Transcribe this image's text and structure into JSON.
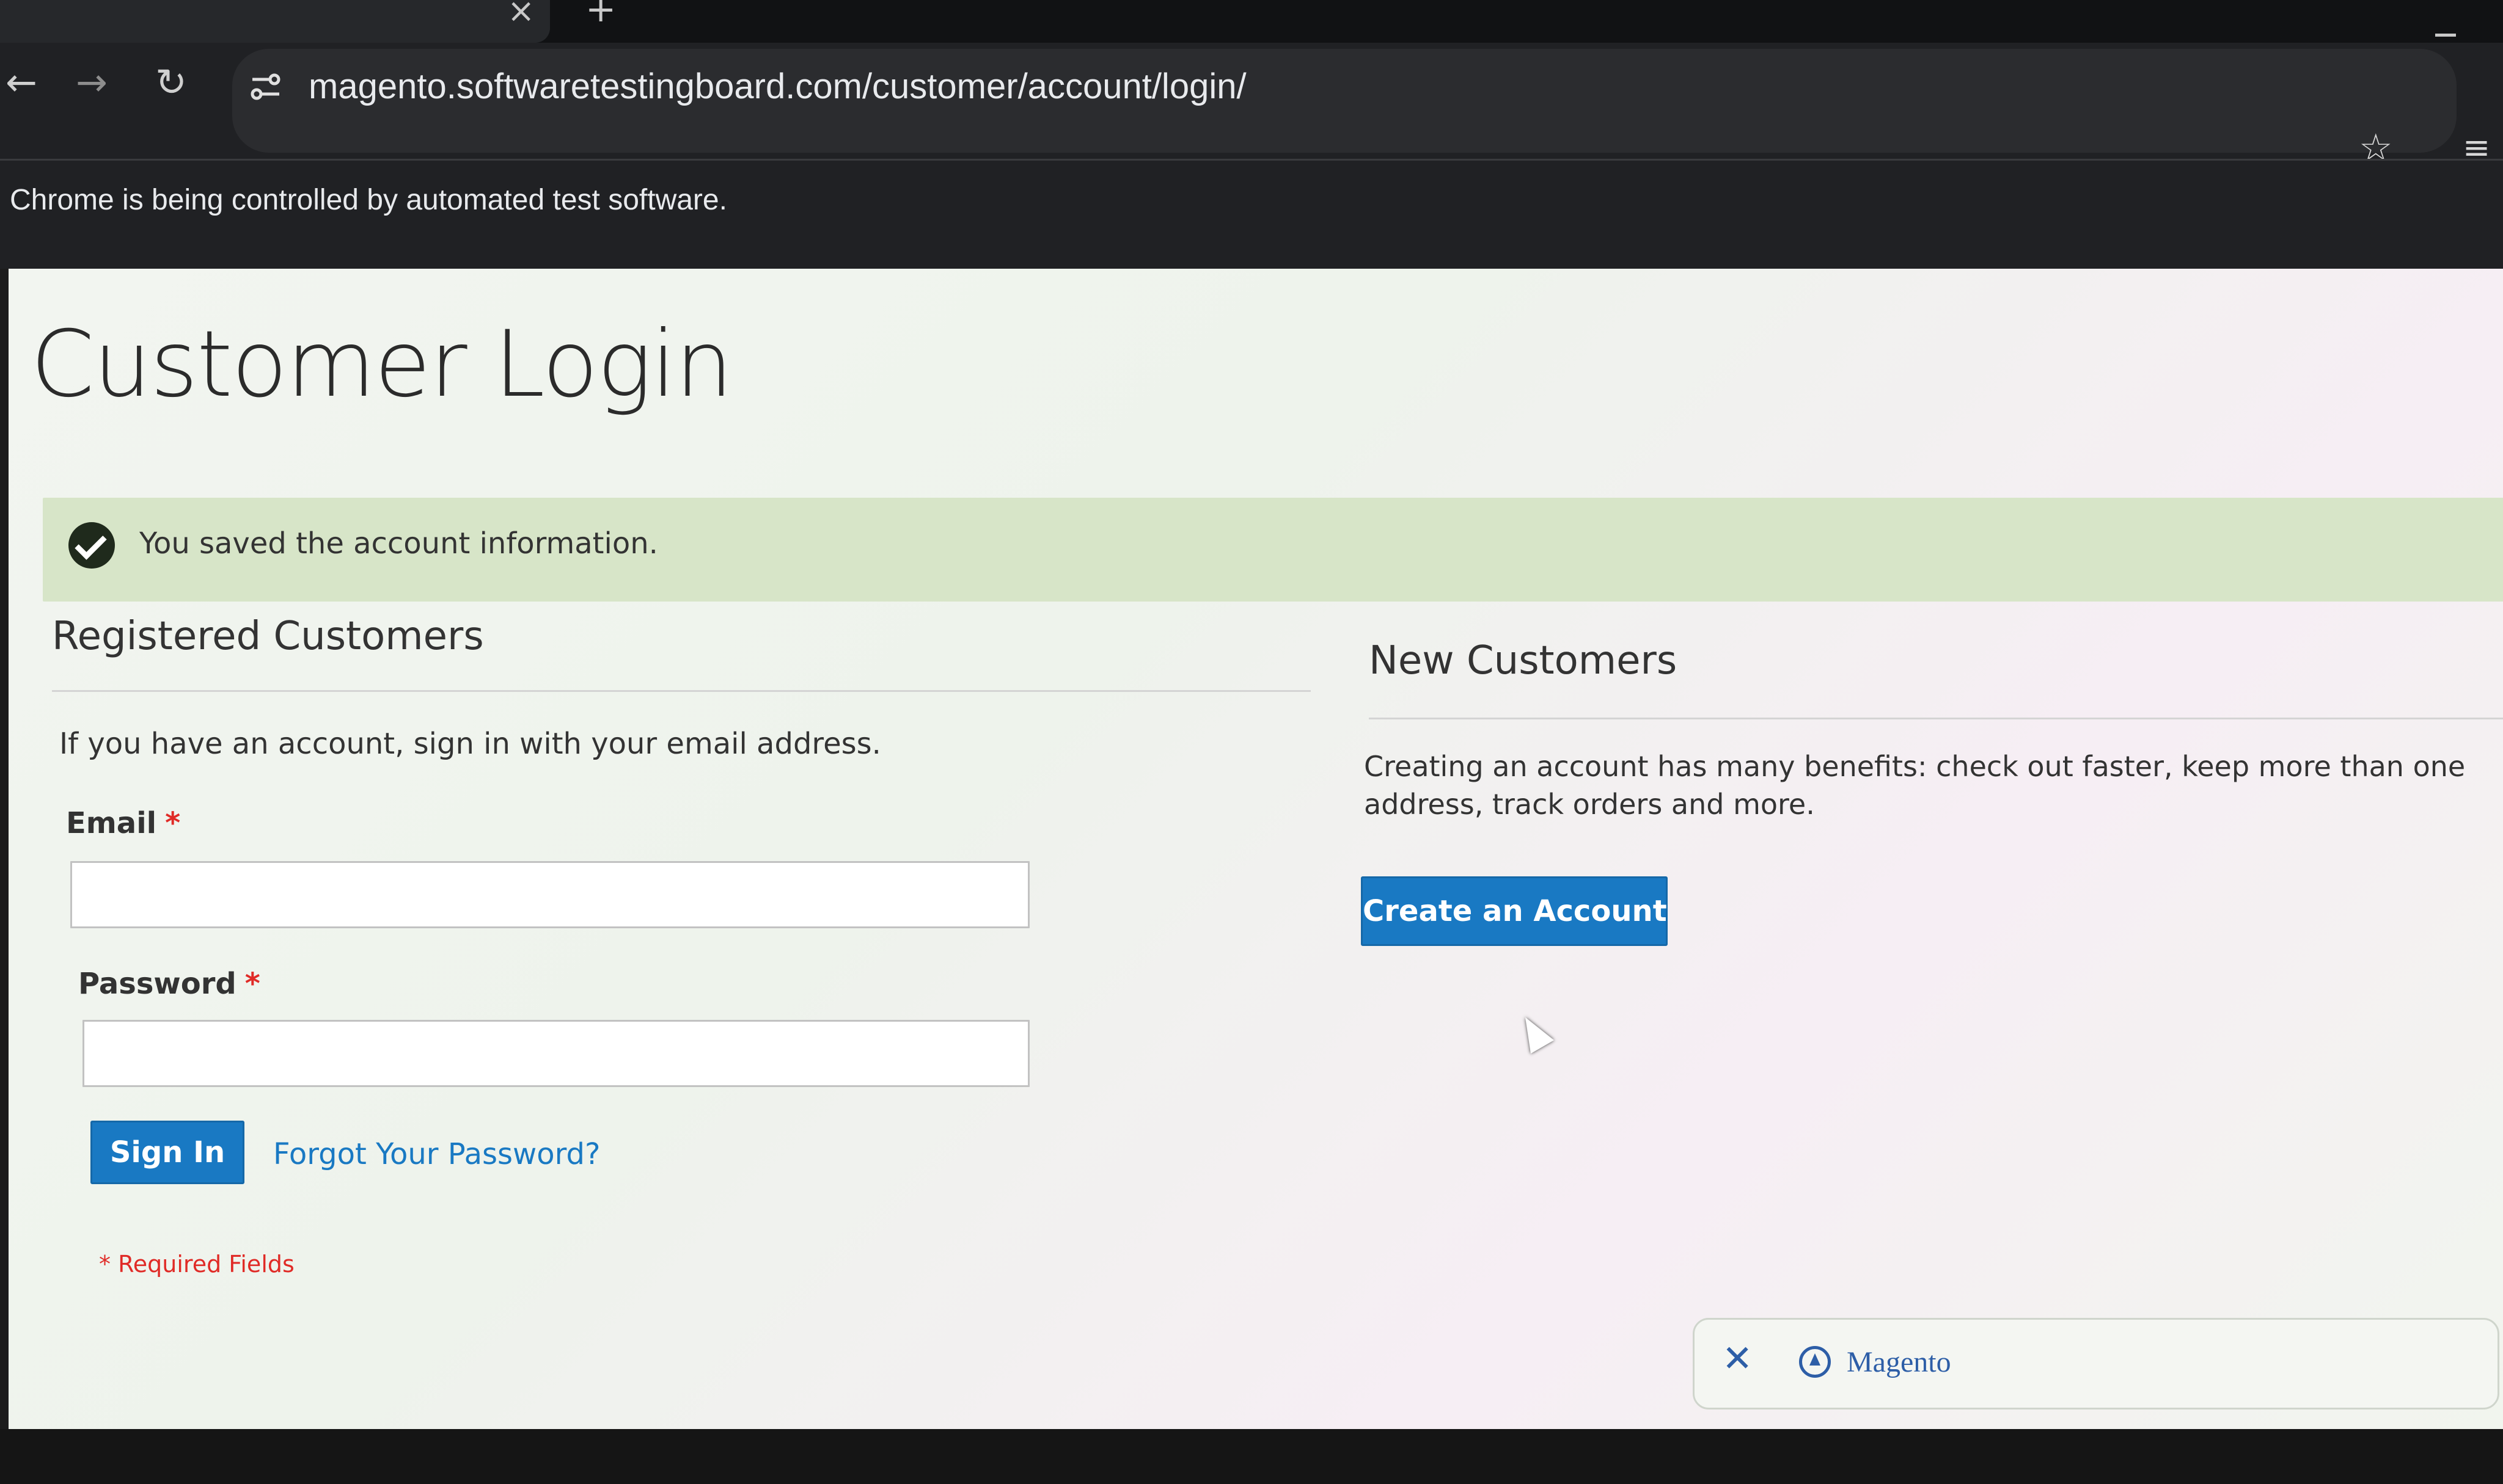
{
  "browser": {
    "url": "magento.softwaretestingboard.com/customer/account/login/",
    "automation_notice": "Chrome is being controlled by automated test software.",
    "icons": {
      "back": "arrow-left-icon",
      "forward": "arrow-right-icon",
      "reload": "reload-icon",
      "site_info": "tune-icon",
      "bookmark": "star-icon",
      "tab_close": "close-icon",
      "new_tab": "plus-icon",
      "media": "playlist-icon"
    }
  },
  "page": {
    "title": "Customer Login",
    "success_message": "You saved the account information.",
    "registered": {
      "title": "Registered Customers",
      "intro": "If you have an account, sign in with your email address.",
      "email_label": "Email",
      "password_label": "Password",
      "required_marker": "*",
      "email_value": "",
      "password_value": "",
      "sign_in_label": "Sign In",
      "forgot_label": "Forgot Your Password?",
      "required_note": "* Required Fields"
    },
    "new_customers": {
      "title": "New Customers",
      "intro": "Creating an account has many benefits: check out faster, keep more than one address, track orders and more.",
      "create_label": "Create an Account"
    }
  },
  "extension_pill": {
    "label": "Magento"
  },
  "colors": {
    "primary": "#1979c3",
    "success_bg": "#d7e5c8",
    "required": "#e02b27",
    "browser_bg": "#202124"
  }
}
